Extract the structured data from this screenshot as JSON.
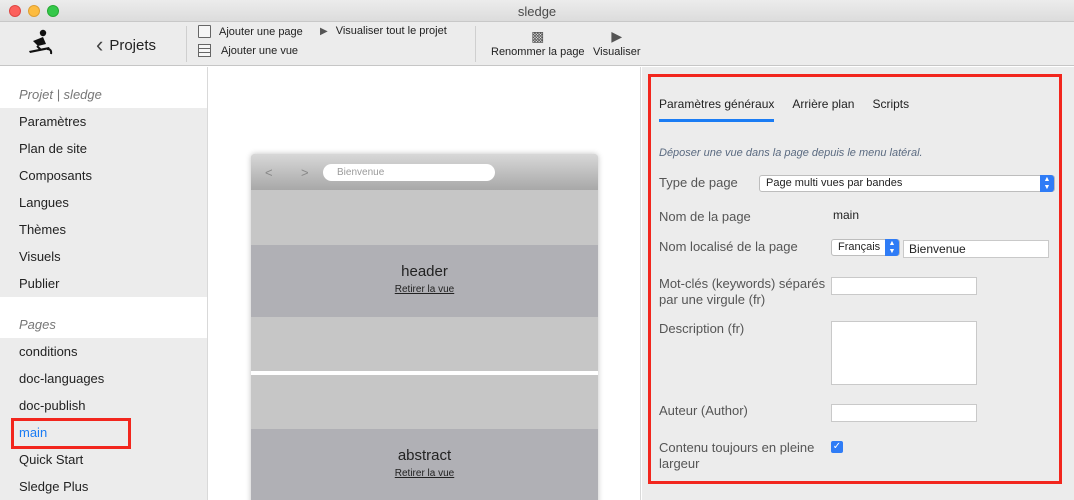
{
  "window": {
    "title": "sledge"
  },
  "toolbar": {
    "back_label": "Projets",
    "add_page": "Ajouter une page",
    "add_view": "Ajouter une vue",
    "preview_all": "Visualiser tout le projet",
    "rename_page": "Renommer la page",
    "preview": "Visualiser"
  },
  "sidebar": {
    "project_title": "Projet | sledge",
    "project_items": [
      "Paramètres",
      "Plan de site",
      "Composants",
      "Langues",
      "Thèmes",
      "Visuels",
      "Publier"
    ],
    "pages_title": "Pages",
    "pages": [
      "conditions",
      "doc-languages",
      "doc-publish",
      "main",
      "Quick Start",
      "Sledge Plus"
    ],
    "active_page": "main"
  },
  "canvas": {
    "url_text": "Bienvenue",
    "bands": [
      {
        "title": "header",
        "link": "Retirer la vue"
      },
      {
        "title": "abstract",
        "link": "Retirer la vue"
      }
    ]
  },
  "panel": {
    "tabs": [
      "Paramètres généraux",
      "Arrière plan",
      "Scripts"
    ],
    "active_tab": "Paramètres généraux",
    "hint": "Déposer une vue dans la page depuis le menu latéral.",
    "page_type_label": "Type de page",
    "page_type_value": "Page multi vues par bandes",
    "page_name_label": "Nom de la page",
    "page_name_value": "main",
    "localized_label": "Nom localisé de la page",
    "language_value": "Français",
    "localized_value": "Bienvenue",
    "keywords_label": "Mot-clés (keywords) séparés par une virgule (fr)",
    "keywords_value": "",
    "description_label": "Description (fr)",
    "author_label": "Auteur (Author)",
    "author_value": "",
    "fullwidth_label": "Contenu toujours en pleine largeur",
    "fullwidth_checked": true
  },
  "colors": {
    "accent": "#1a7cf4",
    "highlight": "#f2261d"
  }
}
